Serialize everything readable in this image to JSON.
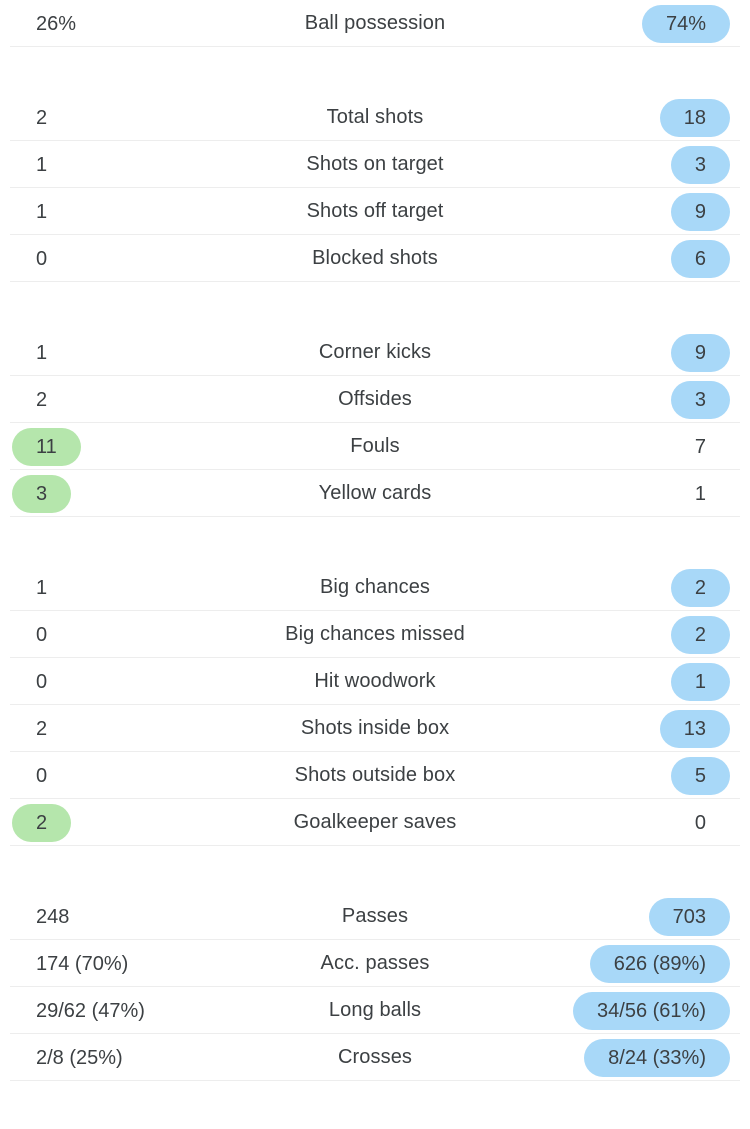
{
  "colors": {
    "highlight_blue": "#a8d8f8",
    "highlight_green": "#b5e6ac",
    "text": "#3c4043",
    "divider": "#ededed",
    "background": "#ffffff"
  },
  "groups": [
    {
      "name": "possession",
      "rows": [
        {
          "label": "Ball possession",
          "home": "26%",
          "away": "74%",
          "home_highlight": "none",
          "away_highlight": "blue"
        }
      ]
    },
    {
      "name": "shots",
      "rows": [
        {
          "label": "Total shots",
          "home": "2",
          "away": "18",
          "home_highlight": "none",
          "away_highlight": "blue"
        },
        {
          "label": "Shots on target",
          "home": "1",
          "away": "3",
          "home_highlight": "none",
          "away_highlight": "blue"
        },
        {
          "label": "Shots off target",
          "home": "1",
          "away": "9",
          "home_highlight": "none",
          "away_highlight": "blue"
        },
        {
          "label": "Blocked shots",
          "home": "0",
          "away": "6",
          "home_highlight": "none",
          "away_highlight": "blue"
        }
      ]
    },
    {
      "name": "discipline",
      "rows": [
        {
          "label": "Corner kicks",
          "home": "1",
          "away": "9",
          "home_highlight": "none",
          "away_highlight": "blue"
        },
        {
          "label": "Offsides",
          "home": "2",
          "away": "3",
          "home_highlight": "none",
          "away_highlight": "blue"
        },
        {
          "label": "Fouls",
          "home": "11",
          "away": "7",
          "home_highlight": "green",
          "away_highlight": "none"
        },
        {
          "label": "Yellow cards",
          "home": "3",
          "away": "1",
          "home_highlight": "green",
          "away_highlight": "none"
        }
      ]
    },
    {
      "name": "chances",
      "rows": [
        {
          "label": "Big chances",
          "home": "1",
          "away": "2",
          "home_highlight": "none",
          "away_highlight": "blue"
        },
        {
          "label": "Big chances missed",
          "home": "0",
          "away": "2",
          "home_highlight": "none",
          "away_highlight": "blue"
        },
        {
          "label": "Hit woodwork",
          "home": "0",
          "away": "1",
          "home_highlight": "none",
          "away_highlight": "blue"
        },
        {
          "label": "Shots inside box",
          "home": "2",
          "away": "13",
          "home_highlight": "none",
          "away_highlight": "blue"
        },
        {
          "label": "Shots outside box",
          "home": "0",
          "away": "5",
          "home_highlight": "none",
          "away_highlight": "blue"
        },
        {
          "label": "Goalkeeper saves",
          "home": "2",
          "away": "0",
          "home_highlight": "green",
          "away_highlight": "none"
        }
      ]
    },
    {
      "name": "passing",
      "rows": [
        {
          "label": "Passes",
          "home": "248",
          "away": "703",
          "home_highlight": "none",
          "away_highlight": "blue"
        },
        {
          "label": "Acc. passes",
          "home": "174 (70%)",
          "away": "626 (89%)",
          "home_highlight": "none",
          "away_highlight": "blue"
        },
        {
          "label": "Long balls",
          "home": "29/62 (47%)",
          "away": "34/56 (61%)",
          "home_highlight": "none",
          "away_highlight": "blue"
        },
        {
          "label": "Crosses",
          "home": "2/8 (25%)",
          "away": "8/24 (33%)",
          "home_highlight": "none",
          "away_highlight": "blue"
        }
      ]
    }
  ]
}
